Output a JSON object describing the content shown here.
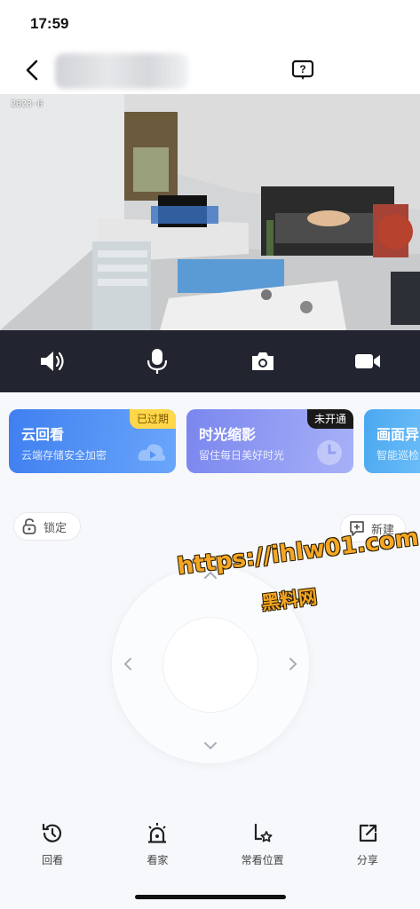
{
  "status_bar": {
    "time": "17:59"
  },
  "camera": {
    "timestamp": "2023-0"
  },
  "cards": [
    {
      "title": "云回看",
      "subtitle": "云端存储安全加密",
      "badge": "已过期",
      "icon": "play-cloud-icon"
    },
    {
      "title": "时光缩影",
      "subtitle": "留住每日美好时光",
      "badge": "未开通",
      "icon": "clock-icon"
    },
    {
      "title": "画面异",
      "subtitle": "智能巡检",
      "icon": "alert-icon"
    }
  ],
  "lock_label": "锁定",
  "new_label": "新建",
  "watermark": {
    "url": "https://ihlw01.com",
    "text": "黑料网"
  },
  "bottom_nav": [
    {
      "label": "回看",
      "icon": "history-icon"
    },
    {
      "label": "看家",
      "icon": "alarm-icon"
    },
    {
      "label": "常看位置",
      "icon": "favorite-location-icon"
    },
    {
      "label": "分享",
      "icon": "share-icon"
    }
  ],
  "colors": {
    "control_bar": "#22252f",
    "card_blue": "#3f7ff0",
    "card_purple": "#7a86ee",
    "badge_yellow": "#ffd74a"
  }
}
